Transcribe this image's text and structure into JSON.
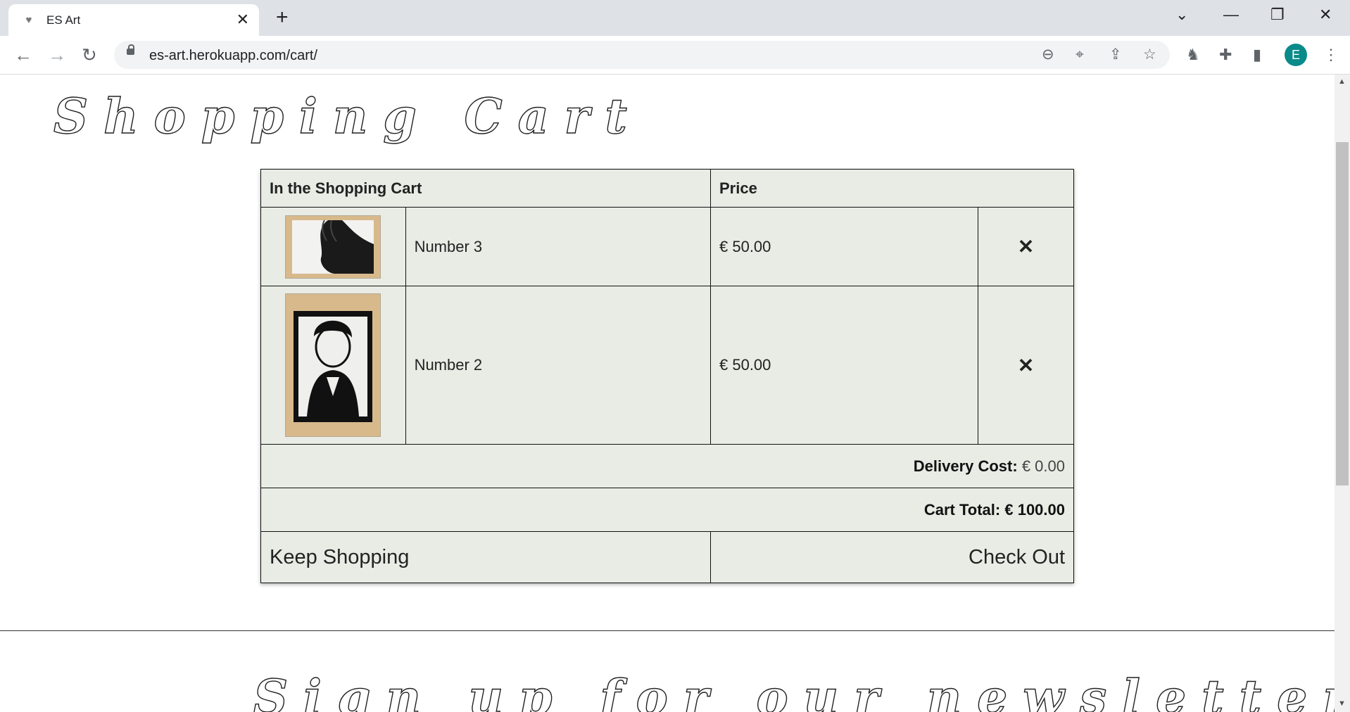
{
  "browser": {
    "tab_title": "ES Art",
    "new_tab": "+",
    "url": "es-art.herokuapp.com/cart/",
    "avatar_letter": "E"
  },
  "page": {
    "heading": "Shopping Cart",
    "table_header": {
      "item": "In the Shopping Cart",
      "price": "Price"
    },
    "items": [
      {
        "name": "Number 3",
        "price": "€ 50.00",
        "remove": "✕"
      },
      {
        "name": "Number 2",
        "price": "€ 50.00",
        "remove": "✕"
      }
    ],
    "delivery_label": "Delivery Cost:",
    "delivery_value": "€ 0.00",
    "total_label": "Cart Total:",
    "total_value": "€ 100.00",
    "keep_shopping": "Keep Shopping",
    "check_out": "Check Out",
    "newsletter_heading": "Sign up for our newsletter"
  },
  "colors": {
    "table_bg": "#e8ece4",
    "accent_avatar": "#0b8a8a"
  }
}
